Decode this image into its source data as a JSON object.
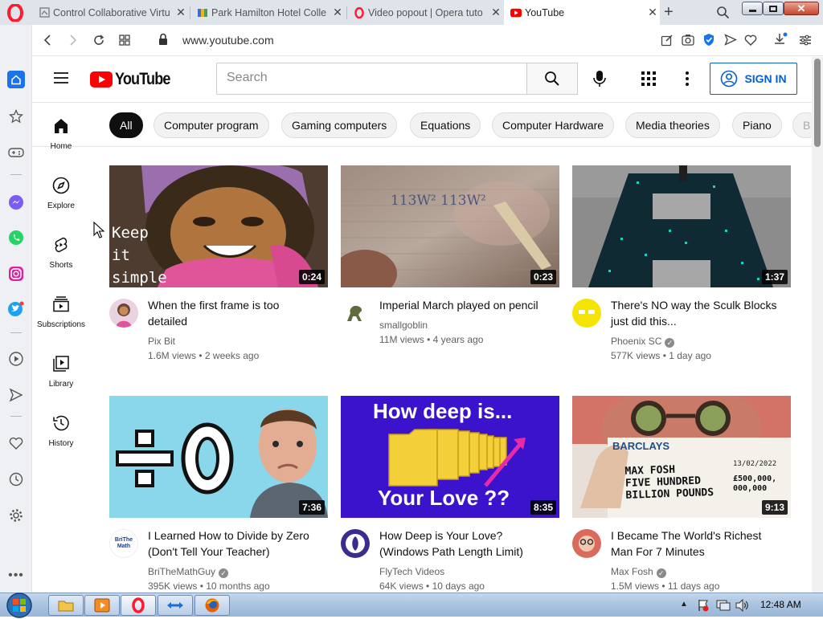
{
  "browser": {
    "tabs": [
      {
        "title": "Control Collaborative Virtu"
      },
      {
        "title": "Park Hamilton Hotel Colle"
      },
      {
        "title": "Video popout | Opera tuto"
      },
      {
        "title": "YouTube"
      }
    ],
    "url": "www.youtube.com"
  },
  "youtube": {
    "logo_text": "YouTube",
    "search_placeholder": "Search",
    "sign_in": "SIGN IN",
    "chips": [
      "All",
      "Computer program",
      "Gaming computers",
      "Equations",
      "Computer Hardware",
      "Media theories",
      "Piano",
      "B"
    ],
    "nav": [
      {
        "label": "Home",
        "icon": "home-icon"
      },
      {
        "label": "Explore",
        "icon": "compass-icon"
      },
      {
        "label": "Shorts",
        "icon": "shorts-icon"
      },
      {
        "label": "Subscriptions",
        "icon": "subscriptions-icon"
      },
      {
        "label": "Library",
        "icon": "library-icon"
      },
      {
        "label": "History",
        "icon": "history-icon"
      }
    ],
    "videos": [
      {
        "title": "When the first frame is too detailed",
        "channel": "Pix Bit",
        "verified": false,
        "views": "1.6M views",
        "age": "2 weeks ago",
        "duration": "0:24",
        "thumb_text": "Keep\nit\nsimple"
      },
      {
        "title": "Imperial March played on pencil",
        "channel": "smallgoblin",
        "verified": false,
        "views": "11M views",
        "age": "4 years ago",
        "duration": "0:23",
        "thumb_text": "113W² 113W²"
      },
      {
        "title": "There's NO way the Sculk Blocks just did this...",
        "channel": "Phoenix SC",
        "verified": true,
        "views": "577K views",
        "age": "1 day ago",
        "duration": "1:37"
      },
      {
        "title": "I Learned How to Divide by Zero (Don't Tell Your Teacher)",
        "channel": "BriTheMathGuy",
        "verified": true,
        "views": "395K views",
        "age": "10 months ago",
        "duration": "7:36",
        "avatar_text": "BriThe Math"
      },
      {
        "title": "How Deep is Your Love? (Windows Path Length Limit)",
        "channel": "FlyTech Videos",
        "verified": false,
        "views": "64K views",
        "age": "10 days ago",
        "duration": "8:35",
        "thumb_top": "How deep is...",
        "thumb_bottom": "Your Love ??"
      },
      {
        "title": "I Became The World's Richest Man For 7 Minutes",
        "channel": "Max Fosh",
        "verified": true,
        "views": "1.5M views",
        "age": "11 days ago",
        "duration": "9:13",
        "thumb_bank": "BARCLAYS",
        "thumb_cheque": "MAX FOSH\nFIVE HUNDRED\nBILLION POUNDS",
        "thumb_amount": "£500,000,\n000,000",
        "thumb_date": "13/02/2022"
      }
    ]
  },
  "taskbar": {
    "clock": "12:48 AM"
  },
  "colors": {
    "yt_red": "#ff0000",
    "link_blue": "#065fd4",
    "opera_red": "#ff1b2d"
  }
}
